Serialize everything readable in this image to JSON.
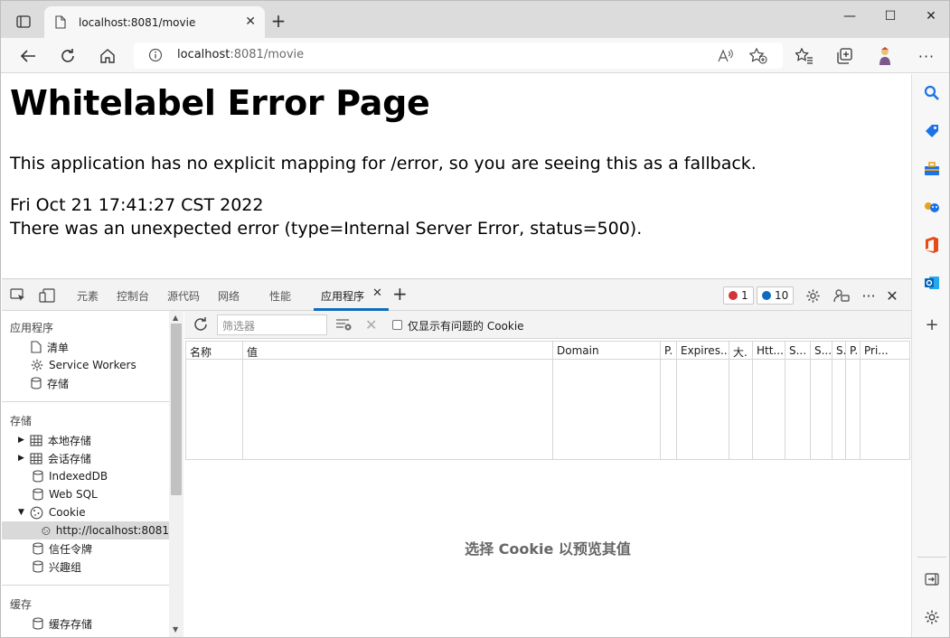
{
  "browser": {
    "tab_title": "localhost:8081/movie",
    "address_host": "localhost",
    "address_rest": ":8081/movie"
  },
  "page": {
    "heading": "Whitelabel Error Page",
    "message": "This application has no explicit mapping for /error, so you are seeing this as a fallback.",
    "timestamp": "Fri Oct 21 17:41:27 CST 2022",
    "error": "There was an unexpected error (type=Internal Server Error, status=500)."
  },
  "devtools": {
    "tabs": [
      "元素",
      "控制台",
      "源代码",
      "网络",
      "性能",
      "应用程序"
    ],
    "errors_count": "1",
    "issues_count": "10",
    "app_panel": {
      "section_app": "应用程序",
      "app_items": [
        "清单",
        "Service Workers",
        "存储"
      ],
      "section_storage": "存储",
      "storage_items": [
        "本地存储",
        "会话存储",
        "IndexedDB",
        "Web SQL",
        "Cookie"
      ],
      "cookie_origin": "http://localhost:8081",
      "more_items": [
        "信任令牌",
        "兴趣组"
      ],
      "section_cache": "缓存",
      "cache_items": [
        "缓存存储"
      ]
    },
    "cookies": {
      "filter_placeholder": "筛选器",
      "only_issues_label": "仅显示有问题的 Cookie",
      "columns": [
        "名称",
        "值",
        "Domain",
        "P.",
        "Expires...",
        "大.",
        "Htt...",
        "S...",
        "S...",
        "S.",
        "P.",
        "Pri..."
      ],
      "preview_text": "选择 Cookie 以预览其值"
    }
  }
}
